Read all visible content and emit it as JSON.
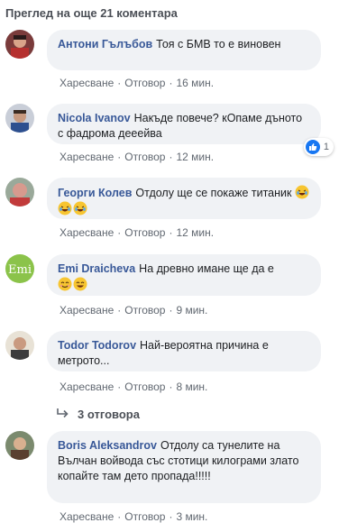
{
  "view_more": "Преглед на още 21 коментара",
  "actions": {
    "like": "Харесване",
    "reply": "Отговор",
    "sep": "·"
  },
  "comments": [
    {
      "author": "Антони Гълъбов",
      "text": "Тоя с БМВ то е виновен",
      "time": "16 мин."
    },
    {
      "author": "Nicola Ivanov",
      "text": "Накъде повече? кОпаме дъното с фадрома дееейва",
      "time": "12 мин.",
      "reactions": "1"
    },
    {
      "author": "Георги Колев",
      "text": "Отдолу ще се покаже титаник",
      "time": "12 мин."
    },
    {
      "author": "Emi Draicheva",
      "text": "На древно имане ще да е",
      "time": "9 мин."
    },
    {
      "author": "Todor Todorov",
      "text": "Най-вероятна причина е метрото...",
      "time": "8 мин."
    },
    {
      "author": "Boris Aleksandrov",
      "text": "Отдолу са тунелите на Вълчан войвода със стотици килограми злато копайте там дето пропада!!!!!",
      "time": "3 мин."
    }
  ],
  "replies_link": "3 отговора",
  "colors": {
    "name": "#385898",
    "bubble": "#f0f2f5",
    "meta": "#606770",
    "like_blue": "#1877f2"
  },
  "icons": [
    "reply-arrow-icon",
    "like-reaction-icon",
    "laughing-emoji-icon",
    "smiling-emoji-icon"
  ]
}
